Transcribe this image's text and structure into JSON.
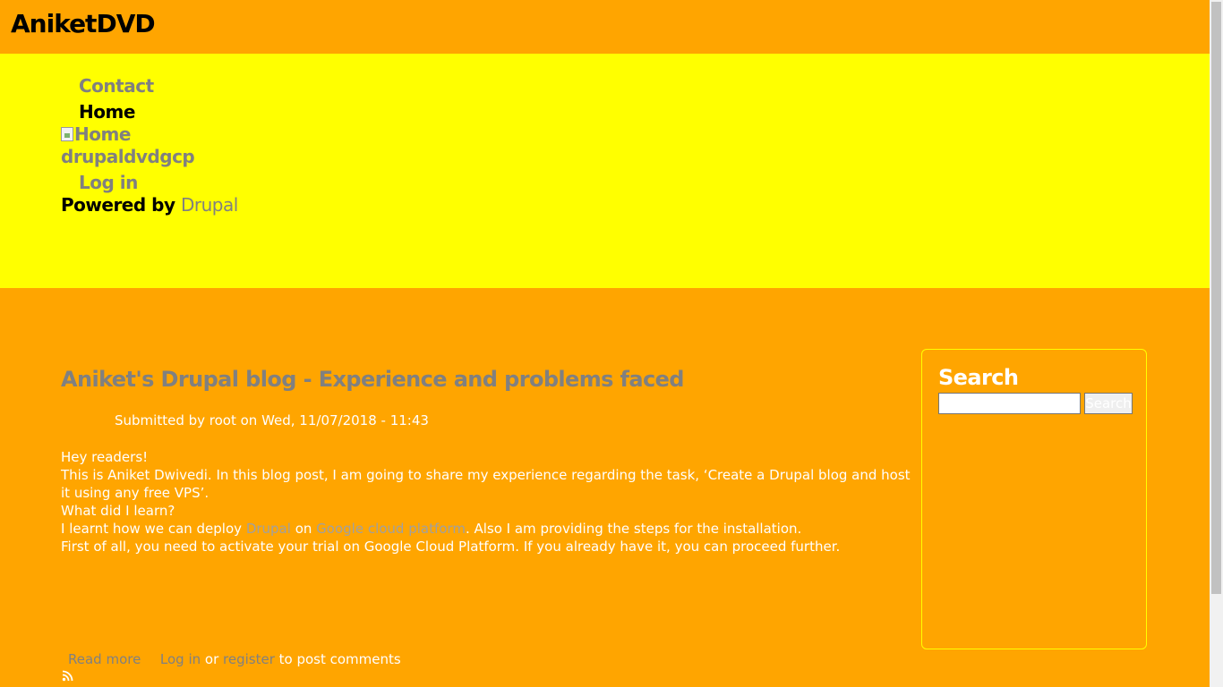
{
  "header": {
    "site_name": "AniketDVD"
  },
  "nav": {
    "contact": "Contact",
    "home": "Home",
    "home_img_alt": "Home",
    "site_link": "drupaldvdgcp",
    "login": "Log in",
    "powered_by": "Powered by",
    "drupal": "Drupal"
  },
  "article": {
    "title": "Aniket's Drupal blog - Experience and problems faced",
    "submitted": "Submitted by root on Wed, 11/07/2018 - 11:43",
    "p1": "Hey readers!",
    "p2": "This is Aniket Dwivedi. In this blog post, I am going to share my experience regarding the task, ‘Create a Drupal blog and host it using any free VPS’.",
    "p3": "What did I learn?",
    "p4_a": "I learnt how we can deploy ",
    "p4_link1": "Drupal",
    "p4_b": " on ",
    "p4_link2": "Google cloud platform",
    "p4_c": ". Also I am providing the steps for the installation.",
    "p5": "First of all, you need to activate your trial on Google Cloud Platform. If you already have it, you can proceed further.",
    "read_more": "Read more",
    "login": "Log in",
    "or": " or ",
    "register": "register",
    "post_comments": " to post comments"
  },
  "sidebar": {
    "title": "Search",
    "search_value": "",
    "button": "Search"
  },
  "icons": {
    "feed": "rss-feed-icon"
  },
  "colors": {
    "background": "#ffa500",
    "nav_band": "#ffff00",
    "link": "#808080"
  }
}
